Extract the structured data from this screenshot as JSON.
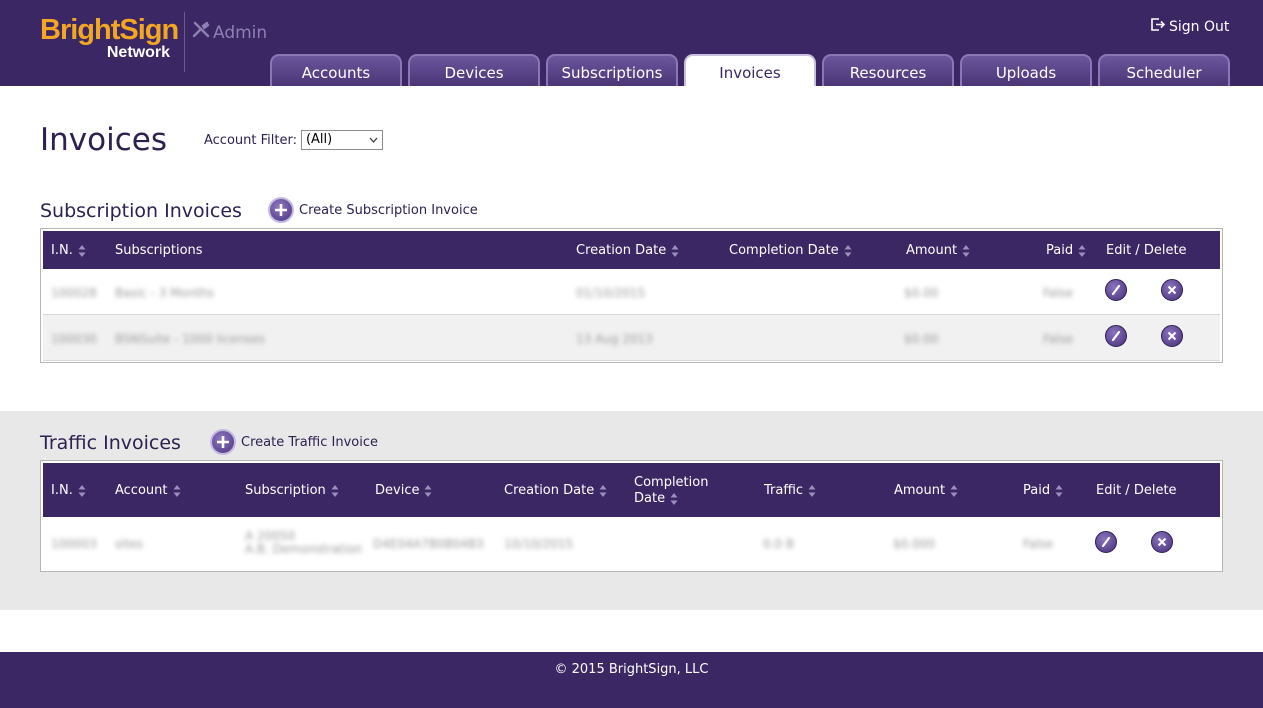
{
  "brand": {
    "name": "BrightSign",
    "sub": "Network",
    "admin_label": "Admin"
  },
  "header": {
    "signout_label": "Sign Out"
  },
  "tabs": [
    {
      "label": "Accounts",
      "active": false
    },
    {
      "label": "Devices",
      "active": false
    },
    {
      "label": "Subscriptions",
      "active": false
    },
    {
      "label": "Invoices",
      "active": true
    },
    {
      "label": "Resources",
      "active": false
    },
    {
      "label": "Uploads",
      "active": false
    },
    {
      "label": "Scheduler",
      "active": false
    }
  ],
  "page": {
    "title": "Invoices",
    "filter_label": "Account Filter:",
    "filter_value": "(All)"
  },
  "subscription_invoices": {
    "title": "Subscription Invoices",
    "create_label": "Create Subscription Invoice",
    "columns": [
      "I.N.",
      "Subscriptions",
      "Creation Date",
      "Completion Date",
      "Amount",
      "Paid",
      "Edit / Delete"
    ],
    "rows": [
      {
        "in": "100028",
        "subscriptions": "Basic - 3 Months",
        "creation_date": "01/10/2015",
        "completion_date": "",
        "amount": "$0.00",
        "paid": "False"
      },
      {
        "in": "100030",
        "subscriptions": "BSNSuite - 1000 licenses",
        "creation_date": "13 Aug 2013",
        "completion_date": "",
        "amount": "$0.00",
        "paid": "False"
      }
    ]
  },
  "traffic_invoices": {
    "title": "Traffic Invoices",
    "create_label": "Create Traffic Invoice",
    "columns": [
      "I.N.",
      "Account",
      "Subscription",
      "Device",
      "Creation Date",
      "Completion Date",
      "Traffic",
      "Amount",
      "Paid",
      "Edit / Delete"
    ],
    "rows": [
      {
        "in": "100003",
        "account": "sites",
        "subscription_1": "A 20050",
        "subscription_2": "A.B. Demonstration",
        "device": "D4E04A7B0B04B3",
        "creation_date": "10/10/2015",
        "completion_date": "",
        "traffic": "0.0 B",
        "amount": "$0.000",
        "paid": "False"
      }
    ]
  },
  "footer": {
    "text": "© 2015 BrightSign, LLC"
  },
  "colors": {
    "header": "#3b2764",
    "accent": "#f2a623",
    "band": "#e8e8e8"
  }
}
